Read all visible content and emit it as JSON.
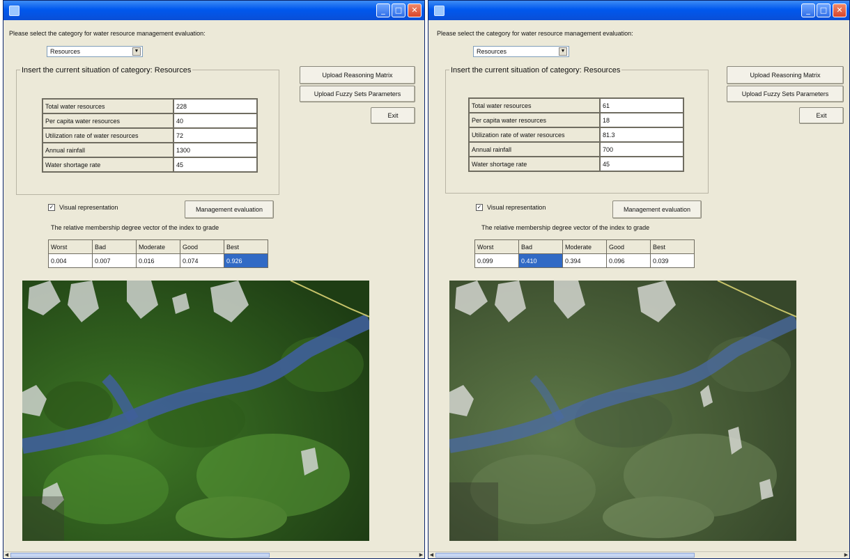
{
  "instruction": "Please select the category for water resource management evaluation:",
  "windows": [
    {
      "category_value": "Resources",
      "group_title": "Insert the current situation of category: Resources",
      "buttons": {
        "upload_matrix": "Upload Reasoning Matrix",
        "upload_fuzzy": "Upload Fuzzy Sets Parameters",
        "exit": "Exit",
        "evaluate": "Management evaluation"
      },
      "visual_label": "Visual representation",
      "visual_checked": true,
      "rows": [
        {
          "label": "Total water resources",
          "value": "228"
        },
        {
          "label": "Per capita water resources",
          "value": "40"
        },
        {
          "label": "Utilization rate of water resources",
          "value": "72"
        },
        {
          "label": "Annual rainfall",
          "value": "1300"
        },
        {
          "label": "Water shortage rate",
          "value": "45"
        }
      ],
      "degree_caption": "The relative membership degree vector of the index to grade",
      "grades": [
        "Worst",
        "Bad",
        "Moderate",
        "Good",
        "Best"
      ],
      "degrees": [
        "0.004",
        "0.007",
        "0.016",
        "0.074",
        "0.926"
      ],
      "selected_grade_index": 4
    },
    {
      "category_value": "Resources",
      "group_title": "Insert the current situation of category: Resources",
      "buttons": {
        "upload_matrix": "Upload Reasoning Matrix",
        "upload_fuzzy": "Upload Fuzzy Sets Parameters",
        "exit": "Exit",
        "evaluate": "Management evaluation"
      },
      "visual_label": "Visual representation",
      "visual_checked": true,
      "rows": [
        {
          "label": "Total water resources",
          "value": "61"
        },
        {
          "label": "Per capita water resources",
          "value": "18"
        },
        {
          "label": "Utilization rate of water resources",
          "value": "81.3"
        },
        {
          "label": "Annual rainfall",
          "value": "700"
        },
        {
          "label": "Water shortage rate",
          "value": "45"
        }
      ],
      "degree_caption": "The relative membership degree vector of the index to grade",
      "grades": [
        "Worst",
        "Bad",
        "Moderate",
        "Good",
        "Best"
      ],
      "degrees": [
        "0.099",
        "0.410",
        "0.394",
        "0.096",
        "0.039"
      ],
      "selected_grade_index": 1
    }
  ],
  "colors": {
    "titlebar": "#0058ee",
    "selection": "#316ac5",
    "window_bg": "#ece9d8",
    "forest_left": "#2f5a1e",
    "forest_right": "#4a5e3a",
    "water": "#3f5f9a"
  },
  "icons": [
    "minimize-icon",
    "maximize-icon",
    "close-icon",
    "dropdown-arrow-icon",
    "check-icon",
    "scroll-left-icon",
    "scroll-right-icon"
  ]
}
